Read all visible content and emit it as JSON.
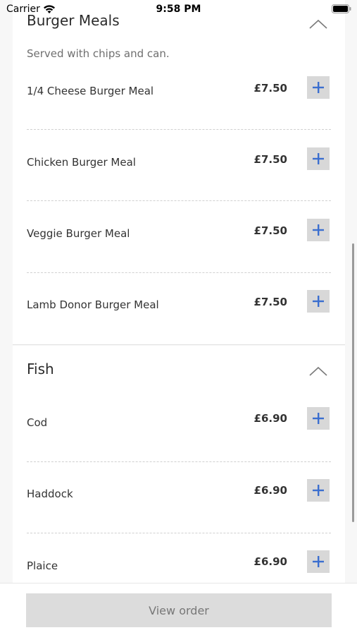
{
  "status_bar": {
    "carrier": "Carrier",
    "time": "9:58 PM"
  },
  "sections": [
    {
      "title": "Burger Meals",
      "description": "Served with chips and can.",
      "items": [
        {
          "name": "1/4 Cheese Burger Meal",
          "price": "£7.50"
        },
        {
          "name": "Chicken Burger Meal",
          "price": "£7.50"
        },
        {
          "name": "Veggie Burger Meal",
          "price": "£7.50"
        },
        {
          "name": "Lamb Donor Burger Meal",
          "price": "£7.50"
        }
      ]
    },
    {
      "title": "Fish",
      "items": [
        {
          "name": "Cod",
          "price": "£6.90"
        },
        {
          "name": "Haddock",
          "price": "£6.90"
        },
        {
          "name": "Plaice",
          "price": "£6.90"
        }
      ]
    }
  ],
  "footer": {
    "view_order_label": "View order"
  },
  "colors": {
    "accent": "#3b6fcf",
    "button_bg": "#d8d8d8",
    "footer_button_bg": "#dcdcdc"
  },
  "icons": {
    "wifi": "wifi-icon",
    "battery": "battery-icon",
    "collapse": "chevron-up-icon",
    "add": "plus-icon"
  }
}
